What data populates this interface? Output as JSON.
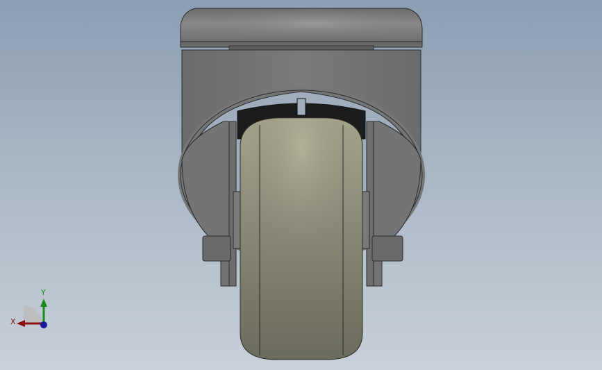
{
  "triad": {
    "x_label": "X",
    "y_label": "Y",
    "colors": {
      "x": "#8a1010",
      "y": "#1a8a1a",
      "z": "#1a1aa0"
    }
  },
  "model": {
    "colors": {
      "housing": "#737373",
      "tire": "#7f7f6c",
      "tread_band": "#1c1c1c"
    }
  }
}
